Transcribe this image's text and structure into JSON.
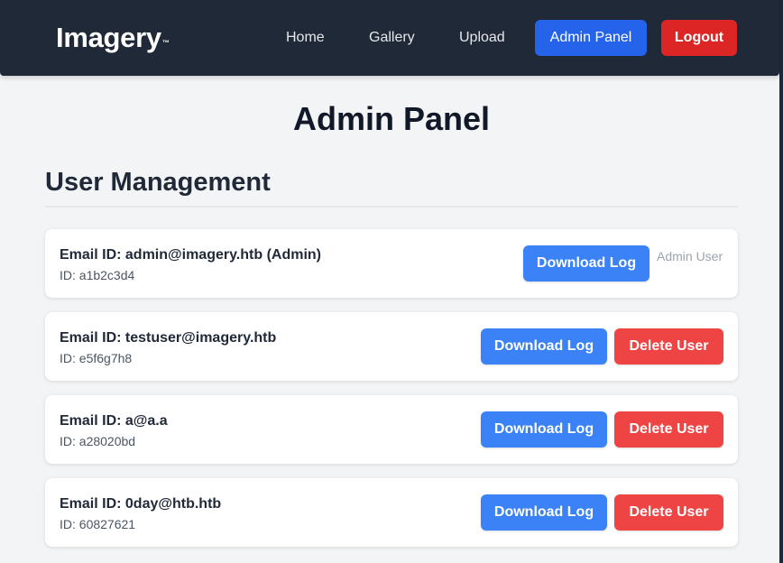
{
  "brand": {
    "name": "Imagery",
    "tm": "™"
  },
  "nav": {
    "home": "Home",
    "gallery": "Gallery",
    "upload": "Upload",
    "admin_panel": "Admin Panel",
    "logout": "Logout"
  },
  "page": {
    "title": "Admin Panel",
    "section_title": "User Management"
  },
  "users": [
    {
      "email_line": "Email ID: admin@imagery.htb (Admin)",
      "id_line": "ID: a1b2c3d4",
      "download_label": "Download Log",
      "admin_note": "Admin User"
    },
    {
      "email_line": "Email ID: testuser@imagery.htb",
      "id_line": "ID: e5f6g7h8",
      "download_label": "Download Log",
      "delete_label": "Delete User"
    },
    {
      "email_line": "Email ID: a@a.a",
      "id_line": "ID: a28020bd",
      "download_label": "Download Log",
      "delete_label": "Delete User"
    },
    {
      "email_line": "Email ID: 0day@htb.htb",
      "id_line": "ID: 60827621",
      "download_label": "Download Log",
      "delete_label": "Delete User"
    }
  ],
  "colors": {
    "navbar": "#1f2937",
    "primary": "#3b82f6",
    "nav_primary": "#2563eb",
    "danger": "#ef4444",
    "nav_danger": "#dc2626",
    "page_bg": "#f3f4f6"
  }
}
